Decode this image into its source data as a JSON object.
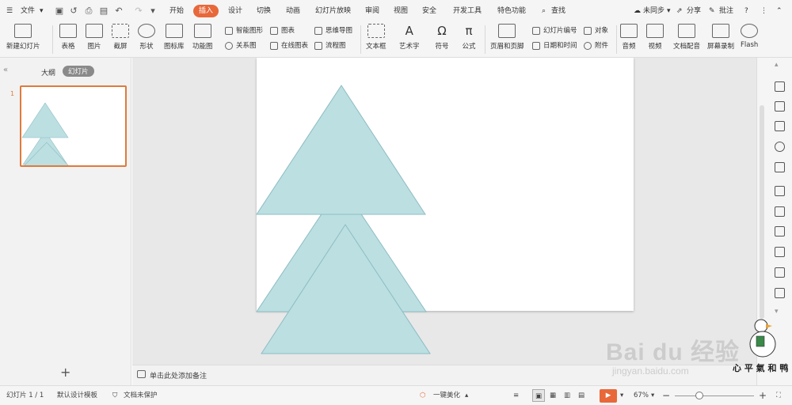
{
  "menu": {
    "file": "文件",
    "tabs": [
      "开始",
      "插入",
      "设计",
      "切换",
      "动画",
      "幻灯片放映",
      "审阅",
      "视图",
      "安全",
      "开发工具",
      "特色功能"
    ],
    "active_tab_index": 1,
    "search": "查找",
    "sync": "未同步",
    "share": "分享",
    "comment": "批注"
  },
  "ribbon": {
    "new_slide": "新建幻灯片",
    "table": "表格",
    "picture": "图片",
    "screenshot": "截屏",
    "shape": "形状",
    "icon_lib": "图标库",
    "func_chart": "功能图",
    "smart_art": "智能图形",
    "chart": "图表",
    "mind_map": "思维导图",
    "relation": "关系图",
    "online_chart": "在线图表",
    "flowchart": "流程图",
    "textbox": "文本框",
    "art_text": "艺术字",
    "symbol": "符号",
    "formula": "公式",
    "header_footer": "页眉和页脚",
    "slide_number": "幻灯片编号",
    "object": "对象",
    "date_time": "日期和时间",
    "attachment": "附件",
    "audio": "音频",
    "video": "视频",
    "doc_voice": "文档配音",
    "screen_record": "屏幕录制",
    "flash": "Flash"
  },
  "left_panel": {
    "outline_tab": "大纲",
    "slides_tab": "幻灯片",
    "slide_index": "1",
    "add": "+"
  },
  "notes": {
    "placeholder": "单击此处添加备注"
  },
  "status": {
    "slide_count": "幻灯片 1 / 1",
    "template": "默认设计模板",
    "protect": "文档未保护",
    "beautify": "一键美化",
    "zoom": "67%",
    "minus": "−",
    "plus": "+"
  },
  "watermark": {
    "brand": "Bai du 经验",
    "url": "jingyan.baidu.com",
    "handwriting": "心 平 氣 和 鸭"
  },
  "colors": {
    "accent": "#e8683a",
    "triangle_fill": "#bcdfe2",
    "triangle_stroke": "#8cbcc2"
  }
}
